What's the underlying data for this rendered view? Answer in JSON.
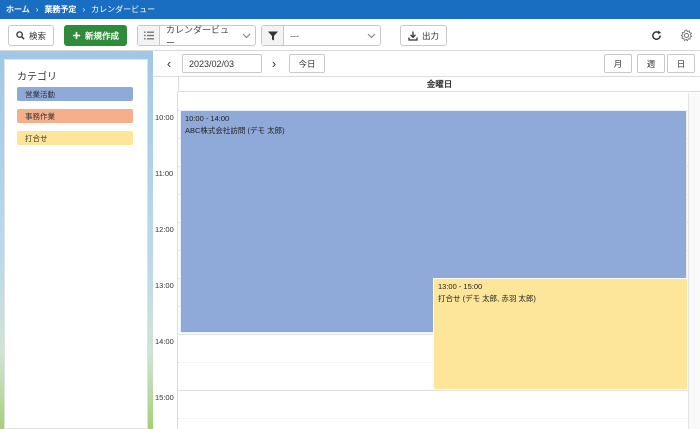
{
  "breadcrumb": {
    "home": "ホーム",
    "section": "業務予定",
    "current": "カレンダービュー",
    "separator": "›"
  },
  "toolbar": {
    "search_label": "検索",
    "new_label": "新規作成",
    "view_select_value": "カレンダービュー",
    "filter_value": "---",
    "export_label": "出力"
  },
  "sidebar": {
    "title": "カテゴリ",
    "categories": [
      {
        "label": "営業活動",
        "color": "#8fa9d9"
      },
      {
        "label": "事務作業",
        "color": "#f5b08a"
      },
      {
        "label": "打合せ",
        "color": "#fde59a"
      }
    ]
  },
  "calendar": {
    "date": "2023/02/03",
    "today_label": "今日",
    "prev_icon": "‹",
    "next_icon": "›",
    "views": {
      "month": "月",
      "week": "週",
      "day": "日"
    },
    "day_header": "金曜日",
    "time_labels": [
      "10:00",
      "11:00",
      "12:00",
      "13:00",
      "14:00",
      "15:00"
    ],
    "events": [
      {
        "time": "10:00 - 14:00",
        "title": "ABC株式会社訪問 (デモ 太郎)",
        "color": "#8fa9d9"
      },
      {
        "time": "13:00 - 15:00",
        "title": "打合せ (デモ 太郎, 赤羽 太郎)",
        "color": "#fde59a"
      }
    ]
  },
  "colors": {
    "topbar": "#1a6ec2",
    "primary_button": "#2e8b3a"
  }
}
